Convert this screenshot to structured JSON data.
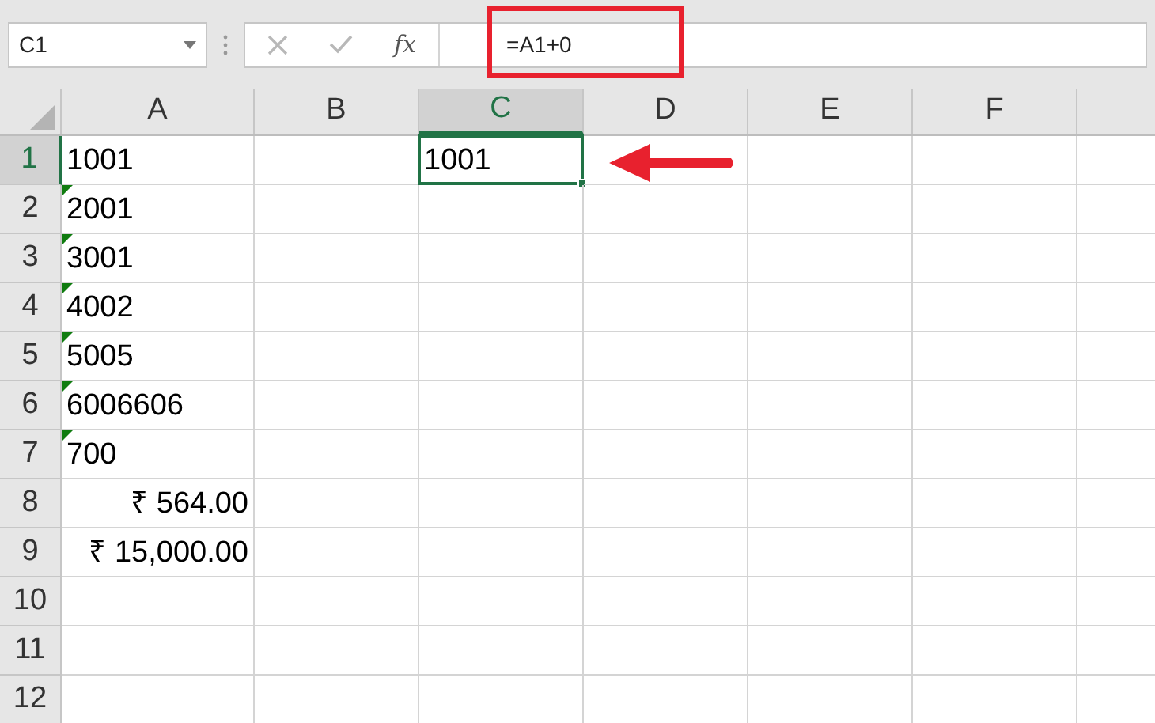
{
  "name_box": {
    "value": "C1"
  },
  "formula_bar": {
    "function_label": "fx",
    "value": "=A1+0",
    "highlighted": true
  },
  "columns": [
    {
      "label": "A",
      "selected": false
    },
    {
      "label": "B",
      "selected": false
    },
    {
      "label": "C",
      "selected": true
    },
    {
      "label": "D",
      "selected": false
    },
    {
      "label": "E",
      "selected": false
    },
    {
      "label": "F",
      "selected": false
    }
  ],
  "rows": [
    {
      "label": "1",
      "selected": true,
      "cells": [
        {
          "value": "1001",
          "kind": "text",
          "error_indicator": false,
          "selected": false
        },
        {},
        {
          "value": "1001",
          "kind": "text",
          "error_indicator": false,
          "selected": true
        },
        {},
        {},
        {}
      ]
    },
    {
      "label": "2",
      "selected": false,
      "cells": [
        {
          "value": "2001",
          "kind": "text",
          "error_indicator": true,
          "selected": false
        },
        {},
        {},
        {},
        {},
        {}
      ]
    },
    {
      "label": "3",
      "selected": false,
      "cells": [
        {
          "value": "3001",
          "kind": "text",
          "error_indicator": true,
          "selected": false
        },
        {},
        {},
        {},
        {},
        {}
      ]
    },
    {
      "label": "4",
      "selected": false,
      "cells": [
        {
          "value": "4002",
          "kind": "text",
          "error_indicator": true,
          "selected": false
        },
        {},
        {},
        {},
        {},
        {}
      ]
    },
    {
      "label": "5",
      "selected": false,
      "cells": [
        {
          "value": "5005",
          "kind": "text",
          "error_indicator": true,
          "selected": false
        },
        {},
        {},
        {},
        {},
        {}
      ]
    },
    {
      "label": "6",
      "selected": false,
      "cells": [
        {
          "value": "6006606",
          "kind": "text",
          "error_indicator": true,
          "selected": false
        },
        {},
        {},
        {},
        {},
        {}
      ]
    },
    {
      "label": "7",
      "selected": false,
      "cells": [
        {
          "value": "700",
          "kind": "text",
          "error_indicator": true,
          "selected": false
        },
        {},
        {},
        {},
        {},
        {}
      ]
    },
    {
      "label": "8",
      "selected": false,
      "cells": [
        {
          "value": "₹ 564.00",
          "kind": "currency",
          "error_indicator": false,
          "selected": false
        },
        {},
        {},
        {},
        {},
        {}
      ]
    },
    {
      "label": "9",
      "selected": false,
      "cells": [
        {
          "value": "₹ 15,000.00",
          "kind": "currency",
          "error_indicator": false,
          "selected": false
        },
        {},
        {},
        {},
        {},
        {}
      ]
    },
    {
      "label": "10",
      "selected": false,
      "cells": [
        {},
        {},
        {},
        {},
        {},
        {}
      ]
    },
    {
      "label": "11",
      "selected": false,
      "cells": [
        {},
        {},
        {},
        {},
        {},
        {}
      ]
    },
    {
      "label": "12",
      "selected": false,
      "cells": [
        {},
        {},
        {},
        {},
        {},
        {}
      ]
    }
  ],
  "pointer_arrow": {
    "shown": true
  }
}
